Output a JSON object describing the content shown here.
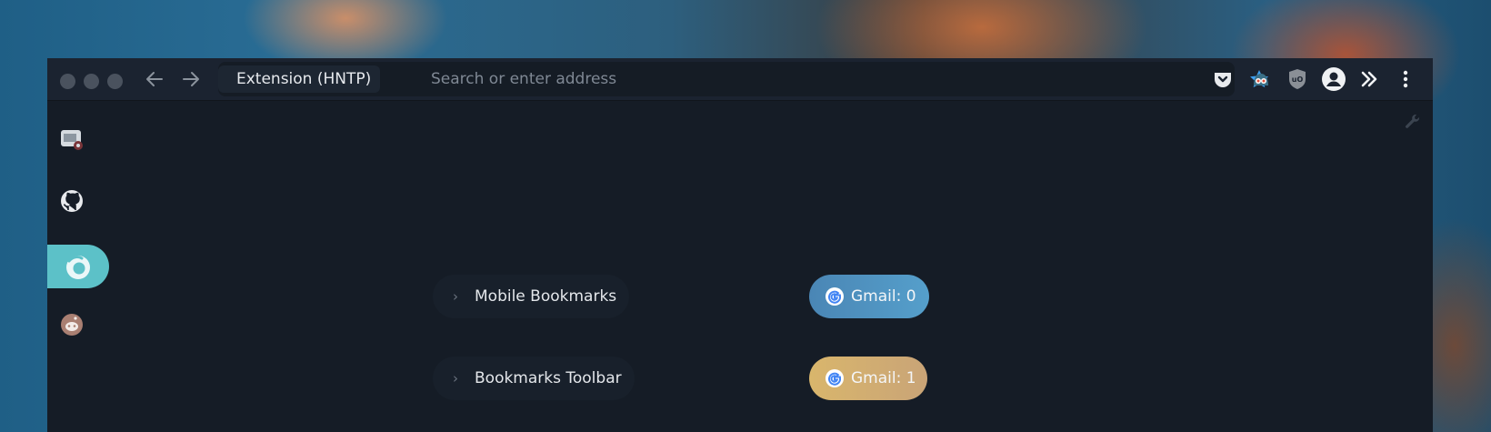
{
  "toolbar": {
    "extension_label": "Extension (HNTP)",
    "address_placeholder": "Search or enter address"
  },
  "icons": {
    "traffic_lights": [
      "close-dot",
      "minimize-dot",
      "maximize-dot"
    ],
    "nav": [
      "back-arrow-icon",
      "forward-arrow-icon"
    ],
    "url_actions": [
      "pocket-icon",
      "bookmark-star-icon"
    ],
    "extensions": [
      "privacy-badger-icon",
      "ublock-origin-icon",
      "account-icon",
      "overflow-chevrons-icon",
      "kebab-menu-icon"
    ],
    "settings": "wrench-icon",
    "sidebar": [
      "screenshot-app-icon",
      "github-icon",
      "firefox-icon",
      "reddit-icon"
    ]
  },
  "sidebar": {
    "active_item": "firefox"
  },
  "bookmarks": {
    "folders": [
      {
        "label": "Mobile Bookmarks"
      },
      {
        "label": "Bookmarks Toolbar"
      }
    ]
  },
  "gmail": [
    {
      "label": "Gmail: 0",
      "color": "#4f93c2"
    },
    {
      "label": "Gmail: 1",
      "color": "#d4b06a"
    }
  ],
  "colors": {
    "window_bg": "#151c26",
    "titlebar_bg": "#1b2330",
    "accent_star": "#3d9ff0",
    "sidebar_active": "#5cc1c8"
  }
}
